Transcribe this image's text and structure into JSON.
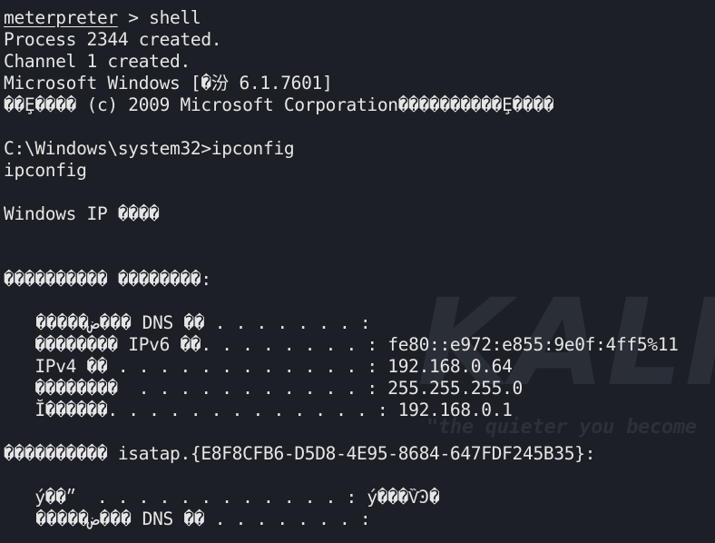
{
  "terminal": {
    "watermark": {
      "logo": "KALI",
      "slogan": "\"the quieter you become"
    },
    "prompt": {
      "name": "meterpreter",
      "rest": " > shell"
    },
    "lines": [
      "Process 2344 created.",
      "Channel 1 created.",
      "Microsoft Windows [�汾 6.1.7601]",
      "��Ȩ���� (c) 2009 Microsoft Corporation����������Ȩ����",
      "",
      "C:\\Windows\\system32>ipconfig",
      "ipconfig",
      "",
      "Windows IP ����",
      "",
      "",
      "���������� ��������:",
      "",
      "   �����ض��� DNS ��׺ . . . . . . . :",
      "   �������� IPv6 ��. . . . . . . . : fe80::e972:e855:9e0f:4ff5%11",
      "   IPv4 �� . . . . . . . . . . . . : 192.168.0.64",
      "   ��������  . . . . . . . . . . . : 255.255.255.0",
      "   Ĭ������. . . . . . . . . . . . . : 192.168.0.1",
      "",
      "���������� isatap.{E8F8CFB6-D5D8-4E95-8684-647FDF245B35}:",
      "",
      "   ý��״  . . . . . . . . . . . . : ý���ѶϿ�",
      "   �����ض��� DNS ��׺ . . . . . . . :"
    ]
  }
}
